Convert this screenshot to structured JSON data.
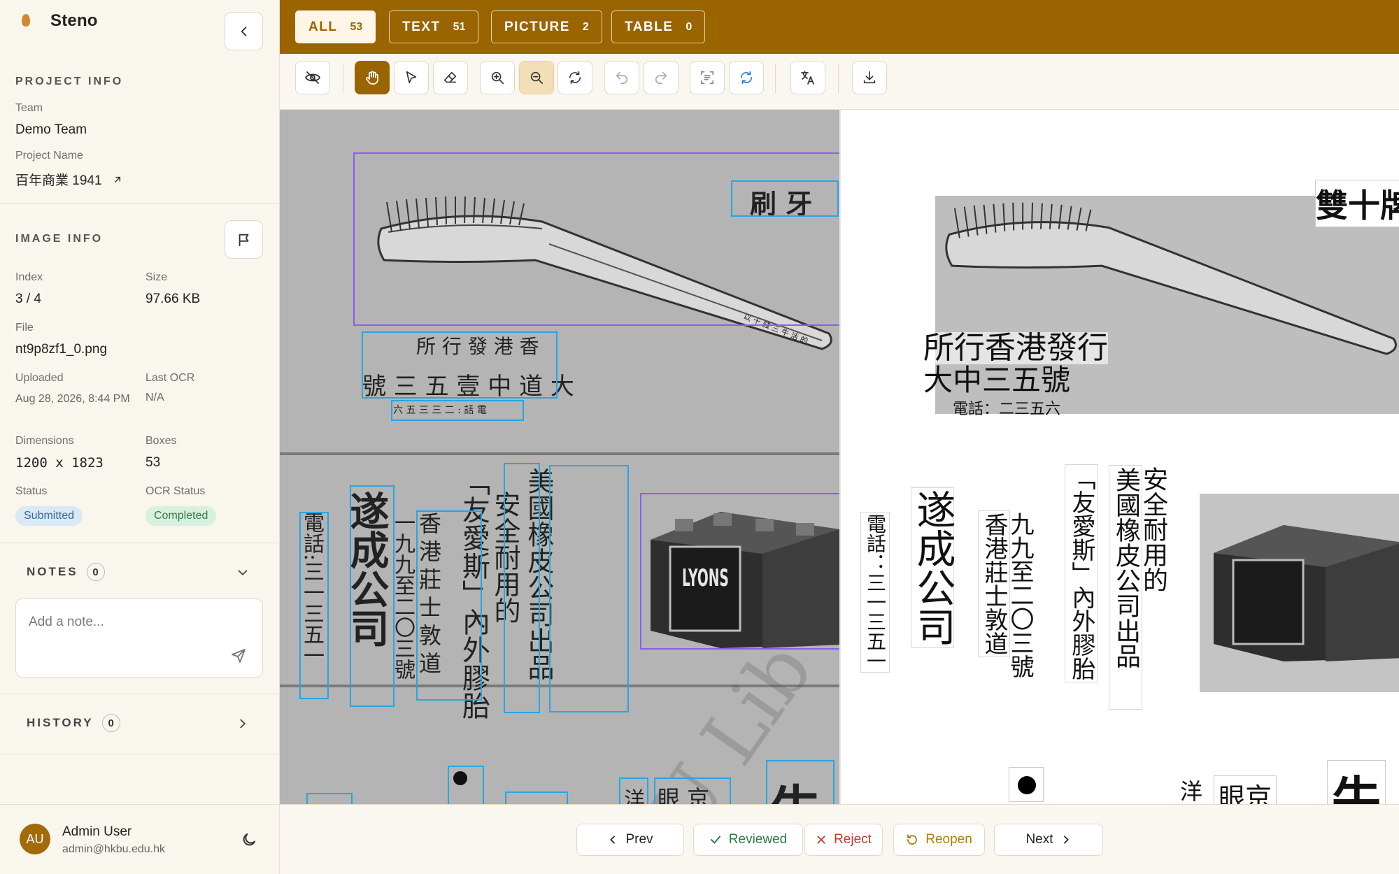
{
  "app": {
    "name": "Steno"
  },
  "project_info": {
    "title": "PROJECT INFO",
    "team_label": "Team",
    "team_value": "Demo Team",
    "name_label": "Project Name",
    "name_value": "百年商業 1941"
  },
  "image_info": {
    "title": "IMAGE INFO",
    "index_label": "Index",
    "index_value": "3 / 4",
    "size_label": "Size",
    "size_value": "97.66 KB",
    "file_label": "File",
    "file_value": "nt9p8zf1_0.png",
    "uploaded_label": "Uploaded",
    "uploaded_value": "Aug 28, 2026, 8:44 PM",
    "last_ocr_label": "Last OCR",
    "last_ocr_value": "N/A",
    "dimensions_label": "Dimensions",
    "dimensions_value": "1200 x 1823",
    "boxes_label": "Boxes",
    "boxes_value": "53",
    "status_label": "Status",
    "status_value": "Submitted",
    "ocr_status_label": "OCR Status",
    "ocr_status_value": "Completed"
  },
  "notes": {
    "title": "NOTES",
    "count": "0",
    "placeholder": "Add a note..."
  },
  "history": {
    "title": "HISTORY",
    "count": "0"
  },
  "user": {
    "initials": "AU",
    "name": "Admin User",
    "email": "admin@hkbu.edu.hk"
  },
  "filters": [
    {
      "label": "ALL",
      "count": "53"
    },
    {
      "label": "TEXT",
      "count": "51"
    },
    {
      "label": "PICTURE",
      "count": "2"
    },
    {
      "label": "TABLE",
      "count": "0"
    }
  ],
  "toolbar_icons": [
    "eye-off-icon",
    "hand-icon",
    "pointer-icon",
    "eraser-icon",
    "zoom-in-icon",
    "zoom-out-icon",
    "rotate-icon",
    "undo-icon",
    "redo-icon",
    "scan-text-icon",
    "refresh-icon",
    "translate-icon",
    "download-icon"
  ],
  "scan": {
    "top_right_h": "刷 牙",
    "small_script": "以 十 錢 三 牛 活 的",
    "addr_line1": "所 行 發 港 香",
    "addr_line2": "號 三 五 壹 中 道 大",
    "addr_line3": "六 五 三 三 二 : 話 電",
    "col_phone": "電話:三一三五一",
    "col_company": "遂成公司",
    "col_addr2": "香港莊士敦道",
    "col_addr3": "一九九至二〇三號",
    "col_quote": "「友愛斯」內外膠胎",
    "col_safe": "安全耐用的",
    "col_us": "美國橡皮公司出品",
    "brand_label": "LYONS",
    "bottom_1": "洋",
    "bottom_2": "眼 京",
    "bottom_3": "牛",
    "watermark": "U Lib"
  },
  "ocr": {
    "top_right": "雙十牌",
    "addr_line1": "所行香港發行",
    "addr_line2": "大中三五號",
    "addr_line3": "電話：二三五六",
    "col_phone": "電話：三一三五一",
    "col_company": "遂成公司",
    "col_addr_a": "香港莊士敦道",
    "col_addr_b": "九九至二〇三號",
    "col_quote": "「友愛斯」內外膠胎",
    "col_us": "美國橡皮公司出品",
    "col_safe": "安全耐用的",
    "bottom_1": "洋",
    "bottom_2": "眼京",
    "bottom_3": "牛"
  },
  "nav": {
    "prev": "Prev",
    "reviewed": "Reviewed",
    "reject": "Reject",
    "reopen": "Reopen",
    "next": "Next"
  }
}
